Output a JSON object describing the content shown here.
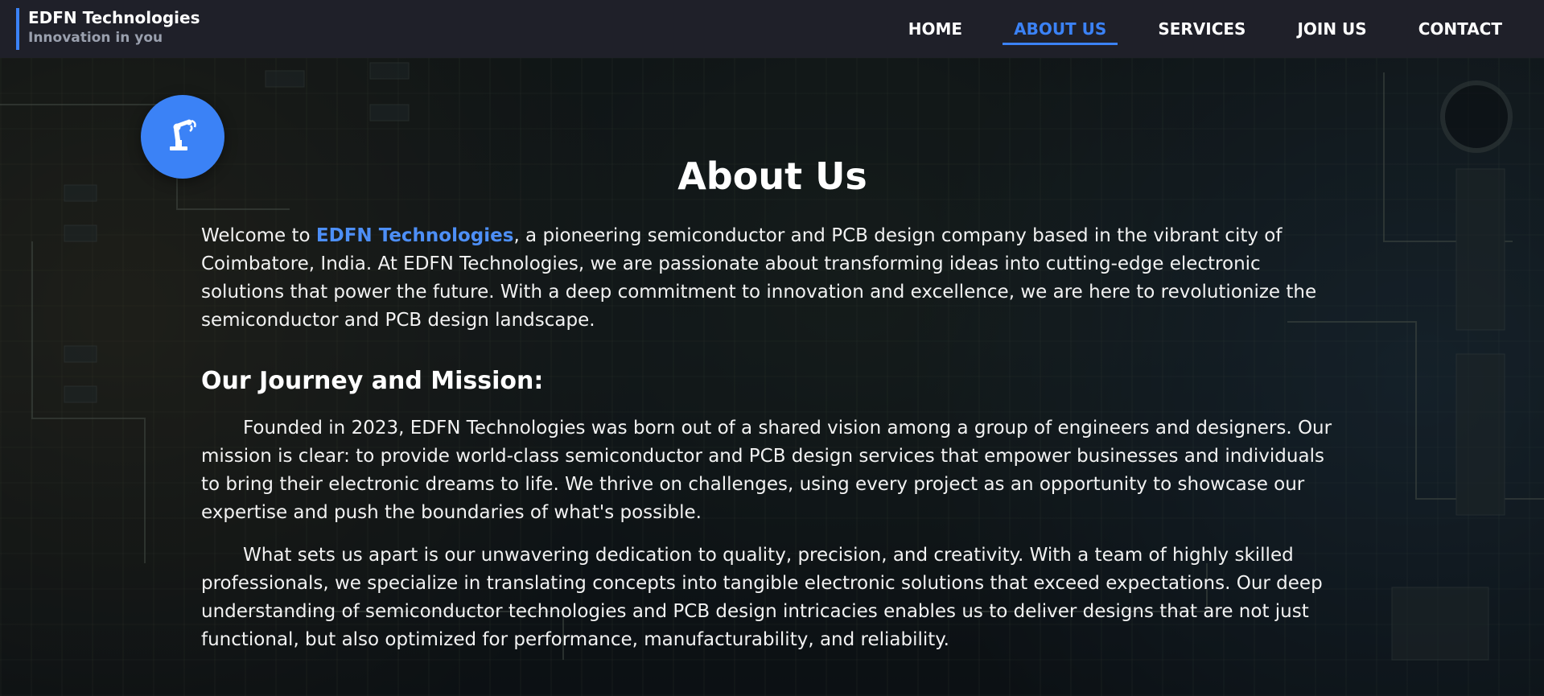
{
  "brand": {
    "name": "EDFN Technologies",
    "tagline": "Innovation in you"
  },
  "nav": [
    {
      "label": "HOME",
      "active": false
    },
    {
      "label": "ABOUT US",
      "active": true
    },
    {
      "label": "SERVICES",
      "active": false
    },
    {
      "label": "JOIN US",
      "active": false
    },
    {
      "label": "CONTACT",
      "active": false
    }
  ],
  "fab": {
    "icon": "robot-arm-icon"
  },
  "about": {
    "title": "About Us",
    "intro_prefix": "Welcome to ",
    "intro_highlight": "EDFN Technologies",
    "intro_rest": ", a pioneering semiconductor and PCB design company based in the vibrant city of Coimbatore, India. At EDFN Technologies, we are passionate about transforming ideas into cutting-edge electronic solutions that power the future. With a deep commitment to innovation and excellence, we are here to revolutionize the semiconductor and PCB design landscape.",
    "journey_title": "Our Journey and Mission:",
    "journey_p1": "Founded in 2023, EDFN Technologies was born out of a shared vision among a group of engineers and designers. Our mission is clear: to provide world-class semiconductor and PCB design services that empower businesses and individuals to bring their electronic dreams to life. We thrive on challenges, using every project as an opportunity to showcase our expertise and push the boundaries of what's possible.",
    "journey_p2": "What sets us apart is our unwavering dedication to quality, precision, and creativity. With a team of highly skilled professionals, we specialize in translating concepts into tangible electronic solutions that exceed expectations. Our deep understanding of semiconductor technologies and PCB design intricacies enables us to deliver designs that are not just functional, but also optimized for performance, manufacturability, and reliability."
  },
  "colors": {
    "accent": "#3b82f6",
    "header_bg": "#1f2029",
    "text": "#ffffff"
  }
}
